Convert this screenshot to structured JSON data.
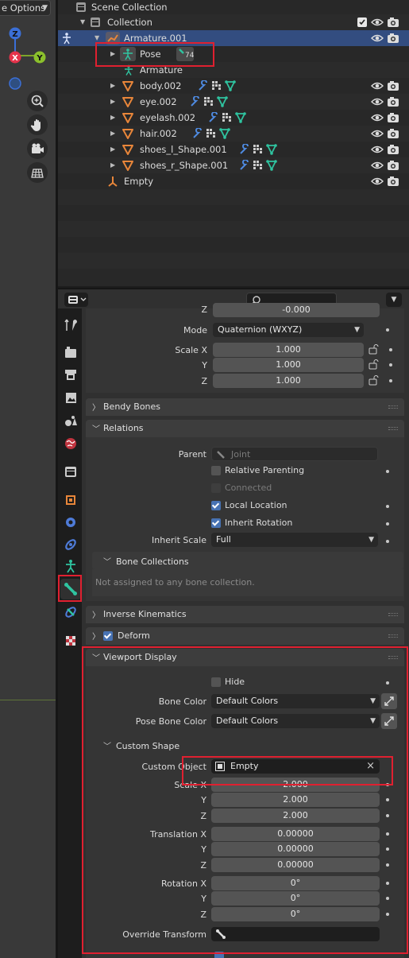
{
  "viewport": {
    "options_label": "e Options",
    "gizmo": {
      "z": "Z",
      "x": "X",
      "y": "Y"
    },
    "tools": [
      "zoom-icon",
      "hand-pan-icon",
      "camera-icon",
      "grid-ortho-icon"
    ]
  },
  "outliner": {
    "rows": [
      {
        "label": "Scene Collection"
      },
      {
        "label": "Collection"
      },
      {
        "label": "Armature.001"
      },
      {
        "label": "Pose",
        "badge": "74"
      },
      {
        "label": "Armature"
      },
      {
        "label": "body.002"
      },
      {
        "label": "eye.002"
      },
      {
        "label": "eyelash.002"
      },
      {
        "label": "hair.002"
      },
      {
        "label": "shoes_l_Shape.001"
      },
      {
        "label": "shoes_r_Shape.001"
      },
      {
        "label": "Empty"
      }
    ]
  },
  "properties": {
    "search_placeholder": "",
    "transform": {
      "top_partial_value": "-0.000",
      "mode_label": "Mode",
      "mode_value": "Quaternion (WXYZ)",
      "scale_labels": [
        "Scale X",
        "Y",
        "Z"
      ],
      "scale_values": [
        "1.000",
        "1.000",
        "1.000"
      ]
    },
    "bendy_bones": {
      "title": "Bendy Bones"
    },
    "relations": {
      "title": "Relations",
      "parent_label": "Parent",
      "parent_value": "Joint",
      "relative_parenting": "Relative Parenting",
      "connected": "Connected",
      "local_location": "Local Location",
      "inherit_rotation": "Inherit Rotation",
      "inherit_scale_label": "Inherit Scale",
      "inherit_scale_value": "Full",
      "bone_collections": "Bone Collections",
      "not_assigned": "Not assigned to any bone collection."
    },
    "inverse_kinematics": {
      "title": "Inverse Kinematics"
    },
    "deform": {
      "title": "Deform"
    },
    "viewport_display": {
      "title": "Viewport Display",
      "hide_label": "Hide",
      "bone_color_label": "Bone Color",
      "bone_color_value": "Default Colors",
      "pose_bone_color_label": "Pose Bone Color",
      "pose_bone_color_value": "Default Colors",
      "custom_shape_title": "Custom Shape",
      "custom_object_label": "Custom Object",
      "custom_object_value": "Empty",
      "scale_labels": [
        "Scale X",
        "Y",
        "Z"
      ],
      "scale_values": [
        "2.000",
        "2.000",
        "2.000"
      ],
      "translation_labels": [
        "Translation X",
        "Y",
        "Z"
      ],
      "translation_values": [
        "0.00000",
        "0.00000",
        "0.00000"
      ],
      "rotation_labels": [
        "Rotation X",
        "Y",
        "Z"
      ],
      "rotation_values": [
        "0°",
        "0°",
        "0°"
      ],
      "override_transform_label": "Override Transform"
    }
  },
  "colors": {
    "highlight_red": "#e02030",
    "selection_blue": "#334d80",
    "checkbox_blue": "#4772b3",
    "bone_green": "#2fc4a0",
    "mesh_orange": "#e8863a"
  }
}
